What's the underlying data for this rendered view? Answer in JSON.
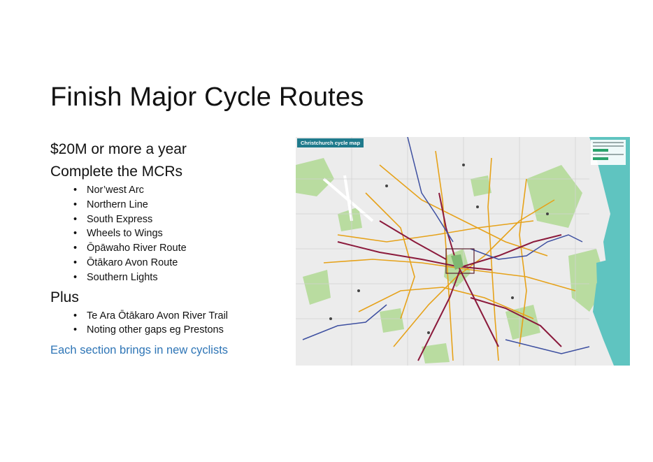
{
  "slide": {
    "title": "Finish Major Cycle Routes"
  },
  "content": {
    "line1": "$20M or more a year",
    "line2": "Complete the MCRs",
    "mcr_routes": [
      "Nor’west Arc",
      "Northern Line",
      "South Express",
      "Wheels to Wings",
      "Ōpāwaho River Route",
      "Ōtākaro Avon Route",
      "Southern Lights"
    ],
    "line3": "Plus",
    "plus_items": [
      "Te Ara Ōtākaro Avon River Trail",
      "Noting other gaps eg Prestons"
    ],
    "note": "Each section brings in new cyclists",
    "note_color": "#2e75b6",
    "bullet_glyph": "•"
  },
  "map": {
    "label": "Christchurch cycle map",
    "colors": {
      "land": "#ececec",
      "park": "#b9dca0",
      "water": "#5fc4c0",
      "major_route": "#8b1a3c",
      "local_route": "#e6a21a",
      "off_road": "#3d4fa0",
      "label_bg": "#1f7a8c"
    }
  }
}
